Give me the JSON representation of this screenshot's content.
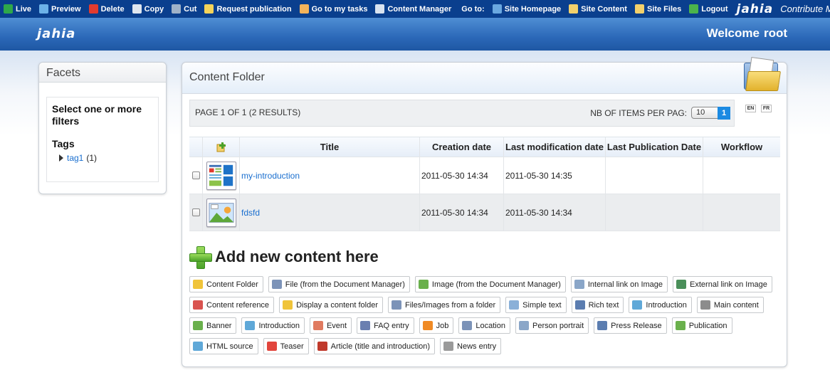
{
  "toolbar": {
    "items": [
      {
        "label": "Live",
        "icon": "globe-icon",
        "color": "#2ea84a"
      },
      {
        "label": "Preview",
        "icon": "preview-icon",
        "color": "#6cb2e8"
      },
      {
        "label": "Delete",
        "icon": "delete-icon",
        "color": "#e23b2e"
      },
      {
        "label": "Copy",
        "icon": "copy-icon",
        "color": "#dfe6ef"
      },
      {
        "label": "Cut",
        "icon": "cut-icon",
        "color": "#9fb2c8"
      },
      {
        "label": "Request publication",
        "icon": "publication-icon",
        "color": "#f4d35a"
      },
      {
        "label": "Go to my tasks",
        "icon": "tasks-icon",
        "color": "#f3b35a"
      },
      {
        "label": "Content Manager",
        "icon": "content-manager-icon",
        "color": "#d9e3f0"
      }
    ],
    "goto_label": "Go to:",
    "goto_items": [
      {
        "label": "Site Homepage",
        "icon": "site-homepage-icon",
        "color": "#6aa8e0"
      },
      {
        "label": "Site Content",
        "icon": "site-content-icon",
        "color": "#f2d06b"
      },
      {
        "label": "Site Files",
        "icon": "site-files-icon",
        "color": "#f2d06b"
      },
      {
        "label": "Logout",
        "icon": "logout-icon",
        "color": "#4bb34b"
      }
    ],
    "logo": "jahia",
    "mode": "Contribute Mode"
  },
  "header": {
    "logo": "jahia",
    "welcome": "Welcome",
    "user": "root"
  },
  "facets": {
    "title": "Facets",
    "lead": "Select one or more filters",
    "tags_heading": "Tags",
    "tag": {
      "label": "tag1",
      "count": "(1)"
    }
  },
  "main": {
    "title": "Content Folder",
    "pager_text": "PAGE 1 OF 1 (2 RESULTS)",
    "per_page_label": "NB OF ITEMS PER PAG:",
    "per_page_value": "10",
    "current_page": "1",
    "languages": [
      "EN",
      "FR"
    ]
  },
  "table": {
    "headers": [
      "Title",
      "Creation date",
      "Last modification date",
      "Last Publication Date",
      "Workflow"
    ],
    "rows": [
      {
        "title": "my-introduction",
        "created": "2011-05-30 14:34",
        "modified": "2011-05-30 14:35",
        "published": "",
        "workflow": "",
        "thumb": "introduction-thumb-icon"
      },
      {
        "title": "fdsfd",
        "created": "2011-05-30 14:34",
        "modified": "2011-05-30 14:34",
        "published": "",
        "workflow": "",
        "thumb": "image-thumb-icon"
      }
    ]
  },
  "add_content": {
    "title": "Add new content here",
    "rows": [
      [
        {
          "label": "Content Folder",
          "icon": "folder-icon",
          "color": "#f0c43a"
        },
        {
          "label": "File (from the Document Manager)",
          "icon": "file-icon",
          "color": "#7c93b8"
        },
        {
          "label": "Image (from the Document Manager)",
          "icon": "image-icon",
          "color": "#6ab04c"
        },
        {
          "label": "Internal link on Image",
          "icon": "internal-link-icon",
          "color": "#8aa6c8"
        },
        {
          "label": "External link on Image",
          "icon": "external-link-icon",
          "color": "#4a8f5a"
        }
      ],
      [
        {
          "label": "Content reference",
          "icon": "reference-icon",
          "color": "#d9534f"
        },
        {
          "label": "Display a content folder",
          "icon": "folder-display-icon",
          "color": "#f0c43a"
        },
        {
          "label": "Files/Images from a folder",
          "icon": "files-images-icon",
          "color": "#7c93b8"
        },
        {
          "label": "Simple text",
          "icon": "simple-text-icon",
          "color": "#8ab0d8"
        },
        {
          "label": "Rich text",
          "icon": "rich-text-icon",
          "color": "#5b7db0"
        },
        {
          "label": "Introduction",
          "icon": "introduction-icon",
          "color": "#5fa8d8"
        },
        {
          "label": "Main content",
          "icon": "main-content-icon",
          "color": "#8c8c8c"
        }
      ],
      [
        {
          "label": "Banner",
          "icon": "banner-icon",
          "color": "#6ab04c"
        },
        {
          "label": "Introduction",
          "icon": "introduction-icon",
          "color": "#5fa8d8"
        },
        {
          "label": "Event",
          "icon": "event-icon",
          "color": "#e07a5f"
        },
        {
          "label": "FAQ entry",
          "icon": "faq-icon",
          "color": "#6a7fb0"
        },
        {
          "label": "Job",
          "icon": "job-icon",
          "color": "#f08a24"
        },
        {
          "label": "Location",
          "icon": "location-icon",
          "color": "#7c93b8"
        },
        {
          "label": "Person portrait",
          "icon": "person-icon",
          "color": "#8aa6c8"
        },
        {
          "label": "Press Release",
          "icon": "press-release-icon",
          "color": "#5b7db0"
        },
        {
          "label": "Publication",
          "icon": "publication-doc-icon",
          "color": "#6ab04c"
        }
      ],
      [
        {
          "label": "HTML source",
          "icon": "html-source-icon",
          "color": "#5fa8d8"
        },
        {
          "label": "Teaser",
          "icon": "teaser-icon",
          "color": "#e2453c"
        },
        {
          "label": "Article (title and introduction)",
          "icon": "article-icon",
          "color": "#c0392b"
        },
        {
          "label": "News entry",
          "icon": "news-icon",
          "color": "#9a9a9a"
        }
      ]
    ]
  }
}
